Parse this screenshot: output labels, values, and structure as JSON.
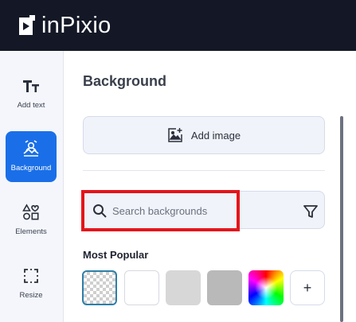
{
  "app": {
    "title": "inPixio",
    "logo_icon": "inpixio-logo-icon"
  },
  "sidebar": {
    "items": [
      {
        "label": "Add text",
        "icon": "text-icon",
        "active": false
      },
      {
        "label": "Background",
        "icon": "background-icon",
        "active": true
      },
      {
        "label": "Elements",
        "icon": "elements-icon",
        "active": false
      },
      {
        "label": "Resize",
        "icon": "resize-icon",
        "active": false
      }
    ]
  },
  "panel": {
    "title": "Background",
    "add_image_label": "Add image",
    "add_image_icon": "image-add-icon",
    "search": {
      "placeholder": "Search backgrounds",
      "value": "",
      "icon": "search-icon",
      "filter_icon": "filter-icon"
    },
    "section_title": "Most Popular",
    "swatches": [
      {
        "kind": "transparent",
        "selected": true
      },
      {
        "kind": "color",
        "color": "#ffffff"
      },
      {
        "kind": "color",
        "color": "#d7d7d7"
      },
      {
        "kind": "color",
        "color": "#b9b9b9"
      },
      {
        "kind": "color-picker"
      }
    ],
    "add_swatch_label": "+"
  },
  "colors": {
    "topbar": "#141826",
    "accent": "#1a6fe8",
    "highlight": "#e5141b"
  }
}
